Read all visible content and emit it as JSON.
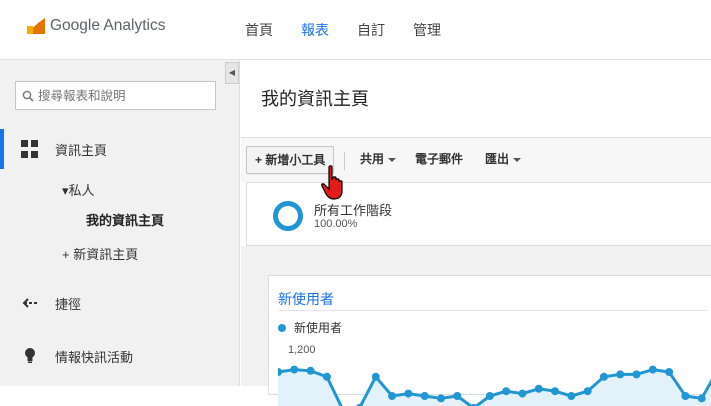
{
  "brand": {
    "name": "Google Analytics"
  },
  "nav": [
    {
      "label": "首頁",
      "active": false
    },
    {
      "label": "報表",
      "active": true
    },
    {
      "label": "自訂",
      "active": false
    },
    {
      "label": "管理",
      "active": false
    }
  ],
  "sidebar": {
    "search_placeholder": "搜尋報表和說明",
    "home_label": "資訊主頁",
    "private_label": "▾私人",
    "my_dashboard_label": "我的資訊主頁",
    "new_dashboard_label": "+ 新資訊主頁",
    "shortcuts_label": "捷徑",
    "intel_label": "情報快訊活動"
  },
  "main": {
    "title": "我的資訊主頁",
    "toolbar": {
      "add_widget": "+ 新增小工具",
      "share": "共用",
      "email": "電子郵件",
      "export": "匯出"
    },
    "segment": {
      "label": "所有工作階段",
      "percent": "100.00%"
    },
    "widget": {
      "title": "新使用者",
      "legend": "新使用者",
      "y_tick": "1,200"
    }
  },
  "colors": {
    "accent": "#1a73e8",
    "series": "#2196d3"
  },
  "chart_data": {
    "type": "line",
    "series": [
      {
        "name": "新使用者",
        "values": [
          1200,
          1210,
          1205,
          1180,
          1040,
          1050,
          1180,
          1100,
          1110,
          1100,
          1090,
          1100,
          1050,
          1100,
          1120,
          1110,
          1130,
          1120,
          1100,
          1120,
          1180,
          1190,
          1190,
          1210,
          1200,
          1100,
          1090,
          1210
        ]
      }
    ],
    "y_ticks": [
      "1,200"
    ]
  }
}
